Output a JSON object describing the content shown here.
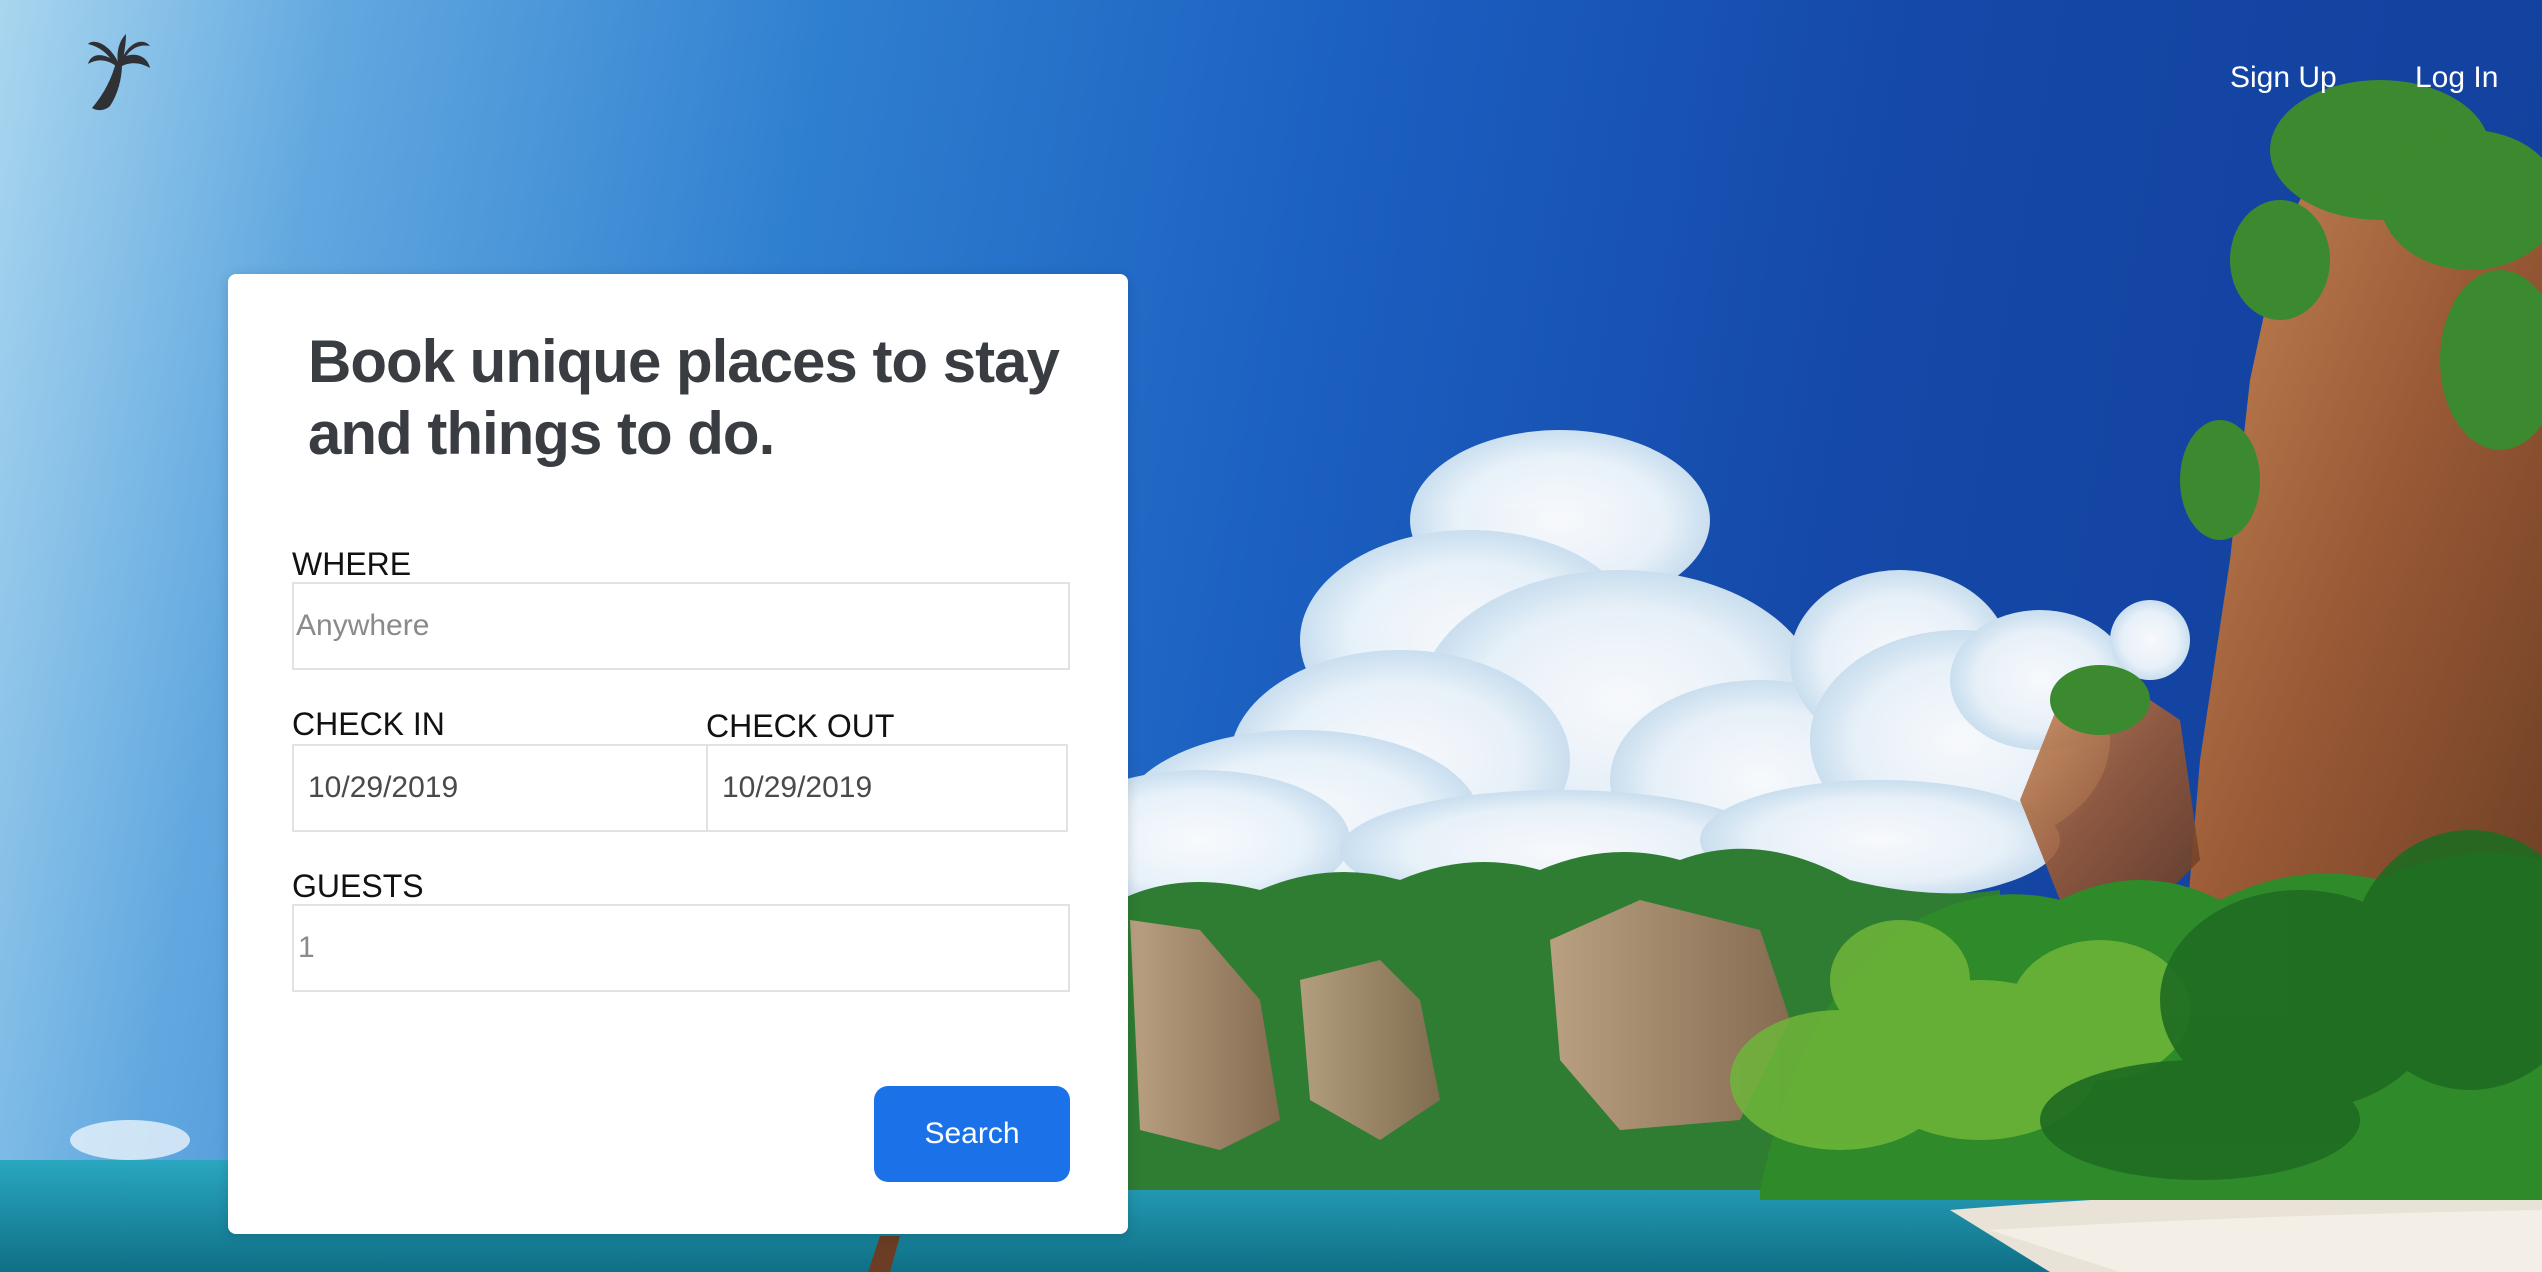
{
  "nav": {
    "logo_icon": "palm-tree-icon",
    "signup_label": "Sign Up",
    "login_label": "Log In"
  },
  "search_card": {
    "headline": "Book unique places to stay and things to do.",
    "where": {
      "label": "WHERE",
      "placeholder": "Anywhere",
      "value": ""
    },
    "check_in": {
      "label": "CHECK IN",
      "value": "10/29/2019"
    },
    "check_out": {
      "label": "CHECK OUT",
      "value": "10/29/2019"
    },
    "guests": {
      "label": "GUESTS",
      "value": "1"
    },
    "search_label": "Search"
  },
  "colors": {
    "accent": "#1b72e8",
    "heading": "#393c41",
    "card_background": "#ffffff"
  }
}
